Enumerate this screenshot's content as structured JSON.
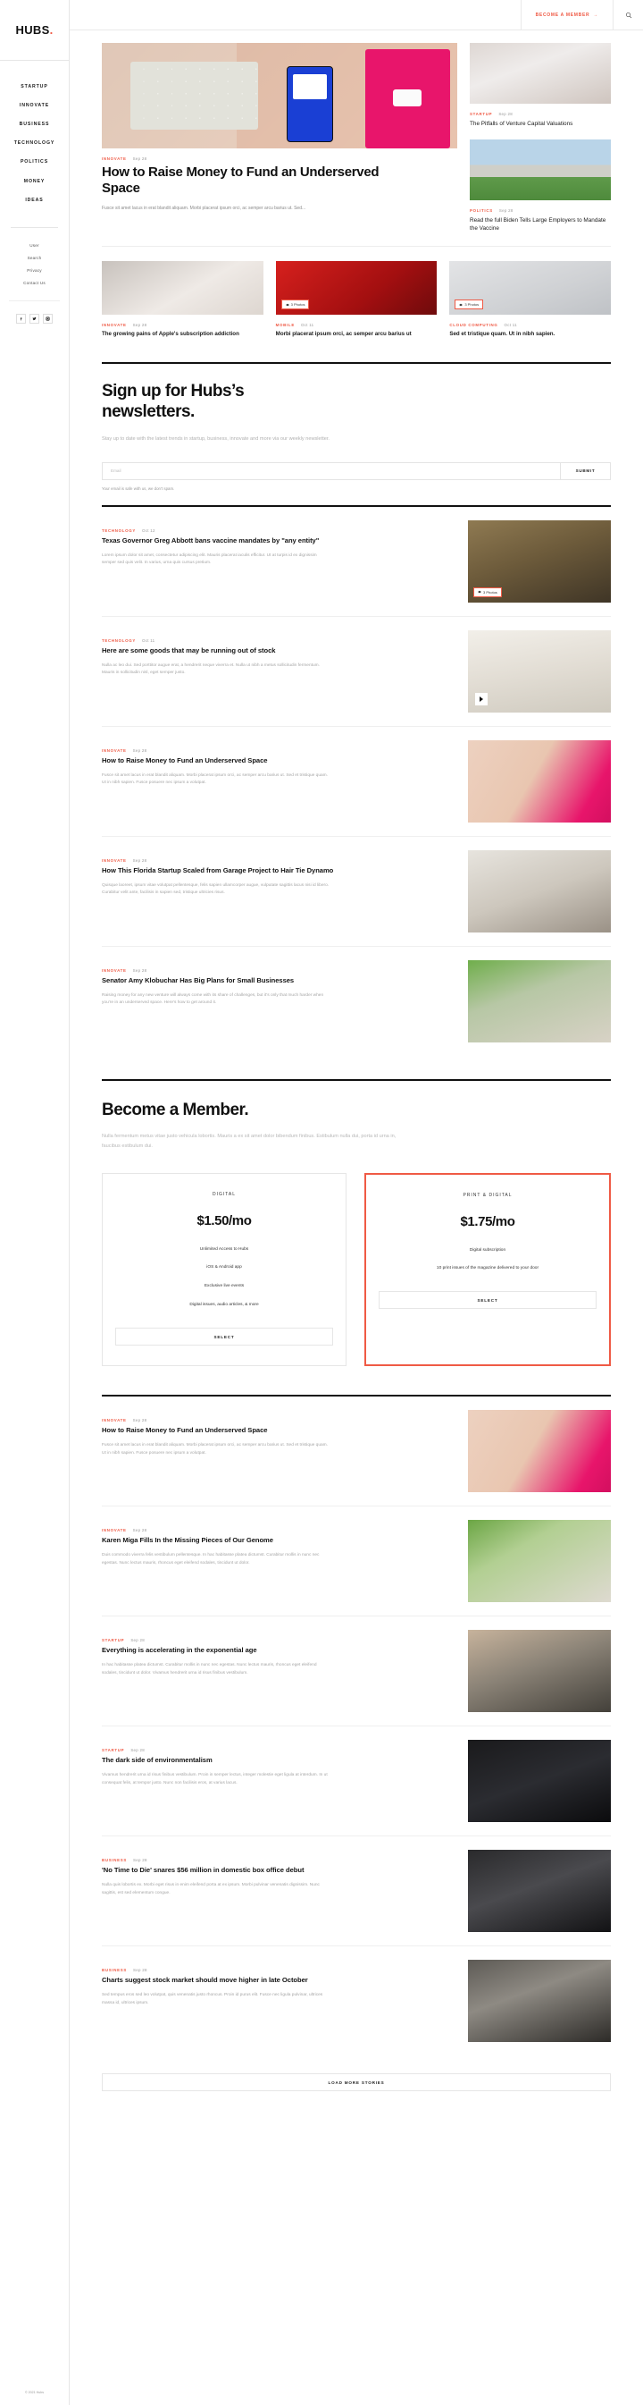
{
  "brand": {
    "name": "HUBS",
    "dot": "."
  },
  "sidebar": {
    "nav": [
      {
        "label": "STARTUP"
      },
      {
        "label": "INNOVATE"
      },
      {
        "label": "BUSINESS"
      },
      {
        "label": "TECHNOLOGY"
      },
      {
        "label": "POLITICS"
      },
      {
        "label": "MONEY"
      },
      {
        "label": "IDEAS"
      }
    ],
    "subnav": [
      {
        "label": "User"
      },
      {
        "label": "Search"
      },
      {
        "label": "Privacy"
      },
      {
        "label": "Contact Us"
      }
    ],
    "social": [
      {
        "name": "facebook-icon"
      },
      {
        "name": "twitter-icon"
      },
      {
        "name": "instagram-icon"
      }
    ],
    "copyright": "© 2021 Hubs"
  },
  "topbar": {
    "member_label": "BECOME A MEMBER",
    "member_arrow": "→",
    "search_icon": "search-icon"
  },
  "hero": {
    "category": "INNOVATE",
    "date": "Sep 28",
    "title": "How to Raise Money to Fund an Underserved Space",
    "excerpt": "Fusce sit amet lacus in erat blandit aliquam. Morbi placerat ipsum orci, ac semper arcu barius ut. Sed..."
  },
  "hero_side": [
    {
      "category": "STARTUP",
      "date": "Sep 28",
      "title": "The Pitfalls of Venture Capital Valuations"
    },
    {
      "category": "POLITICS",
      "date": "Sep 28",
      "title": "Read the full Biden Tells Large Employers to Mandate the Vaccine"
    }
  ],
  "cards3": [
    {
      "category": "INNOVATE",
      "date": "Sep 28",
      "title": "The growing pains of Apple's subscription addiction",
      "badge": ""
    },
    {
      "category": "MOBILE",
      "date": "Oct 11",
      "title": "Morbi placerat ipsum orci, ac semper arcu barius ut",
      "badge": "3 Photos"
    },
    {
      "category": "CLOUD COMPUTING",
      "date": "Oct 11",
      "title": "Sed et tristique quam. Ut in nibh sapien.",
      "badge": "3 Photos"
    }
  ],
  "newsletter": {
    "title": "Sign up for Hubs’s newsletters.",
    "subtitle": "Stay up to date with the latest trends in startup, business, innovate and more via our weekly newsletter.",
    "email_placeholder": "Email",
    "submit_label": "SUBMIT",
    "note": "Your email is safe with us, we don’t spam."
  },
  "list_top": [
    {
      "category": "TECHNOLOGY",
      "date": "Oct 12",
      "title": "Texas Governor Greg Abbott bans vaccine mandates by \"any entity\"",
      "excerpt": "Lorem ipsum dolor sit amet, consectetur adipiscing elit. Mauris placerat iaculis efficitur. Ut at turpis id ex dignissim semper sed quis velit. In varius, urna quis cursus pretium.",
      "badge": "3 Photos",
      "media": "photos"
    },
    {
      "category": "TECHNOLOGY",
      "date": "Oct 11",
      "title": "Here are some goods that may be running out of stock",
      "excerpt": "Nulla ac leo dui. Sed porttitor augue erat, a hendrerit neque viverra et. Nulla ut nibh a metus sollicitudin fermentum. Mauris in sollicitudin nisl, eget semper justo.",
      "badge": "",
      "media": "video"
    },
    {
      "category": "INNOVATE",
      "date": "Sep 28",
      "title": "How to Raise Money to Fund an Underserved Space",
      "excerpt": "Fusce sit amet lacus in erat blandit aliquam. Morbi placerat ipsum orci, ac semper arcu barius ut. Sed et tristique quam. Ut in nibh sapien. Fusce posuere nec ipsum a volutpat.",
      "badge": "",
      "media": "none"
    },
    {
      "category": "INNOVATE",
      "date": "Sep 28",
      "title": "How This Florida Startup Scaled from Garage Project to Hair Tie Dynamo",
      "excerpt": "Quisque laoreet, ipsum vitae volutpat pellentesque, felis sapien ullamcorper augue, vulputate sagittis lacus nisi id libero. Curabitur velit ante, facilisis in sapien sed, tristique ultricies risus.",
      "badge": "",
      "media": "none"
    },
    {
      "category": "INNOVATE",
      "date": "Sep 28",
      "title": "Senator Amy Klobuchar Has Big Plans for Small Businesses",
      "excerpt": "Raising money for any new venture will always come with its share of challenges, but it’s only that much harder when you’re in an underserved space. Here’s how to get around it.",
      "badge": "",
      "media": "none"
    }
  ],
  "membership": {
    "title": "Become a Member.",
    "subtitle": "Nulla fermentum metus vitae justo vehicula lobortis. Mauris a ex sit amet dolor bibendum finibus. Estibulum nulla dui, porta id urna in, faucibus estibulum dui.",
    "plans": [
      {
        "type": "DIGITAL",
        "price": "$1.50/mo",
        "features": [
          "Unlimited Access to Hubs",
          "iOS & Android app",
          "Exclusive live events",
          "Digital issues, audio articles, & more"
        ],
        "button": "SELECT",
        "featured": false
      },
      {
        "type": "PRINT & DIGITAL",
        "price": "$1.75/mo",
        "features": [
          "Digital subscription",
          "10 print issues of the magazine delivered to your door"
        ],
        "button": "SELECT",
        "featured": true
      }
    ],
    "accent": "#ef5a45"
  },
  "list_bottom": [
    {
      "category": "INNOVATE",
      "date": "Sep 28",
      "title": "How to Raise Money to Fund an Underserved Space",
      "excerpt": "Fusce sit amet lacus in erat blandit aliquam. Morbi placerat ipsum orci, ac semper arcu barius ut. Sed et tristique quam. Ut in nibh sapien. Fusce posuere nec ipsum a volutpat."
    },
    {
      "category": "INNOVATE",
      "date": "Sep 28",
      "title": "Karen Miga Fills In the Missing Pieces of Our Genome",
      "excerpt": "Duis commodo viverra felis vestibulum pellentesque. In hac habitasse platea dictumst. Curabitur mollis in nunc nec egestas. Nunc lectus mauris, rhoncus eget eleifend sodales, tincidunt ut dolor."
    },
    {
      "category": "STARTUP",
      "date": "Sep 28",
      "title": "Everything is accelerating in the exponential age",
      "excerpt": "In hac habitasse platea dictumst. Curabitur mollis in nunc nec egestas. Nunc lectus mauris, rhoncus eget eleifend sodales, tincidunt ut dolor. Vivamus hendrerit urna id risus finibus vestibulum."
    },
    {
      "category": "STARTUP",
      "date": "Sep 28",
      "title": "The dark side of environmentalism",
      "excerpt": "Vivamus hendrerit urna id risus finibus vestibulum. Proin in semper lectus, integer molestie eget ligula at interdum. In ut consequat felis, at tempor justo. Nunc non facilisis eros, at varius lacus."
    },
    {
      "category": "BUSINESS",
      "date": "Sep 28",
      "title": "'No Time to Die' snares $56 million in domestic box office debut",
      "excerpt": "Nulla quis lobortis ex. Morbi eget risus in enim eleifend porta at ex ipsum. Morbi pulvinar venenatis dignissim. Nunc sagittis, est sed elementum congue."
    },
    {
      "category": "BUSINESS",
      "date": "Sep 28",
      "title": "Charts suggest stock market should move higher in late October",
      "excerpt": "Sed tempus eros sed leo volutpat, quis venenatis justo rhoncus. Proin id purus elit. Fusce nec ligula pulvinar, ultrices massa id, ultrices ipsum."
    }
  ],
  "load_more": {
    "label": "LOAD MORE STORIES"
  }
}
